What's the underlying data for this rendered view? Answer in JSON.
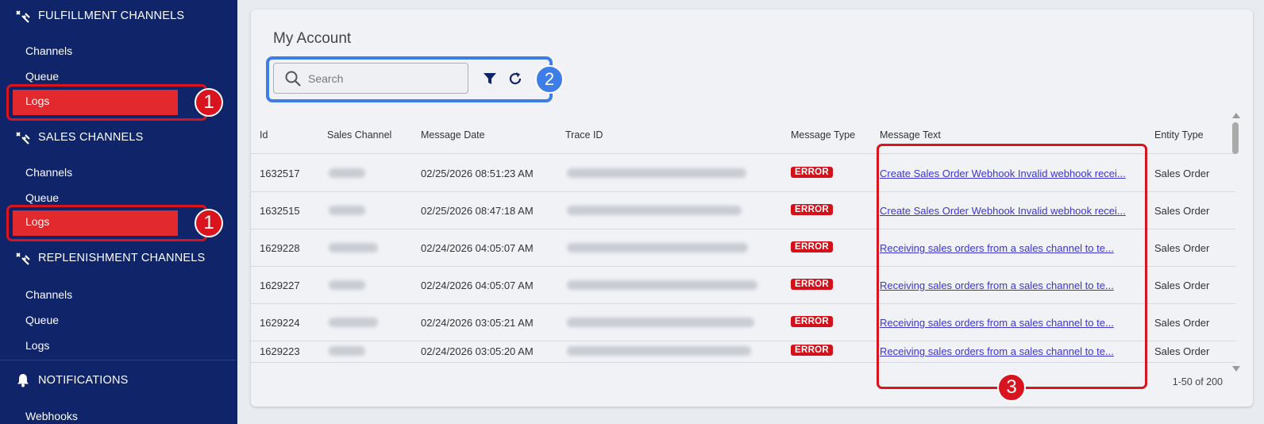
{
  "sidebar": {
    "fulfillment": {
      "title": "FULFILLMENT CHANNELS",
      "icon": "channels-icon",
      "items": [
        "Channels",
        "Queue",
        "Logs"
      ]
    },
    "sales": {
      "title": "SALES CHANNELS",
      "icon": "channels-icon",
      "items": [
        "Channels",
        "Queue",
        "Logs"
      ]
    },
    "replenishment": {
      "title": "REPLENISHMENT CHANNELS",
      "icon": "channels-icon",
      "items": [
        "Channels",
        "Queue",
        "Logs"
      ]
    },
    "notifications": {
      "title": "NOTIFICATIONS",
      "icon": "bell-icon",
      "items": [
        "Webhooks"
      ]
    }
  },
  "annotations": {
    "logs_marker": "1",
    "toolbar_marker": "2",
    "message_text_marker": "3"
  },
  "page": {
    "title": "My Account",
    "search_placeholder": "Search",
    "filter_icon": "filter-icon",
    "refresh_icon": "refresh-icon"
  },
  "table": {
    "columns": [
      "Id",
      "Sales Channel",
      "Message Date",
      "Trace ID",
      "Message Type",
      "Message Text",
      "Entity Type"
    ],
    "rows": [
      {
        "id": "1632517",
        "date": "02/25/2026 08:51:23 AM",
        "type": "ERROR",
        "text": "Create Sales Order Webhook Invalid webhook recei...",
        "entity": "Sales Order"
      },
      {
        "id": "1632515",
        "date": "02/25/2026 08:47:18 AM",
        "type": "ERROR",
        "text": "Create Sales Order Webhook Invalid webhook recei...",
        "entity": "Sales Order"
      },
      {
        "id": "1629228",
        "date": "02/24/2026 04:05:07 AM",
        "type": "ERROR",
        "text": "Receiving sales orders from a sales channel to te...",
        "entity": "Sales Order"
      },
      {
        "id": "1629227",
        "date": "02/24/2026 04:05:07 AM",
        "type": "ERROR",
        "text": "Receiving sales orders from a sales channel to te...",
        "entity": "Sales Order"
      },
      {
        "id": "1629224",
        "date": "02/24/2026 03:05:21 AM",
        "type": "ERROR",
        "text": "Receiving sales orders from a sales channel to te...",
        "entity": "Sales Order"
      },
      {
        "id": "1629223",
        "date": "02/24/2026 03:05:20 AM",
        "type": "ERROR",
        "text": "Receiving sales orders from a sales channel to te...",
        "entity": "Sales Order"
      }
    ],
    "pagination": "1-50 of 200"
  },
  "colors": {
    "sidebar_bg": "#0f2469",
    "active_item": "#e22a2e",
    "error_badge": "#d4111a",
    "link": "#3d35d0",
    "annotation_red": "#d9141e",
    "annotation_blue": "#3d7de8"
  }
}
